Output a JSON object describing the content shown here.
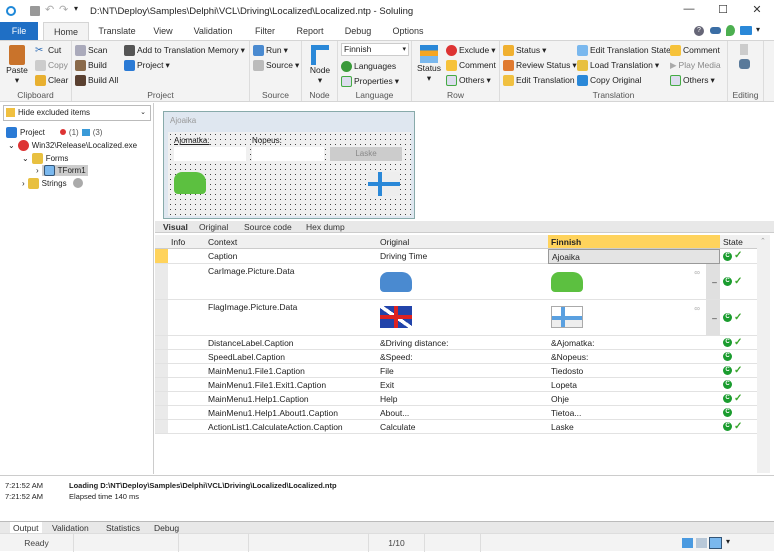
{
  "window": {
    "title": "D:\\NT\\Deploy\\Samples\\Delphi\\VCL\\Driving\\Localized\\Localized.ntp  -  Soluling",
    "minimize": "—",
    "maximize": "☐",
    "close": "✕"
  },
  "menu_tabs": [
    "File",
    "Home",
    "Translate",
    "View",
    "Validation",
    "Filter",
    "Report",
    "Debug",
    "Options"
  ],
  "ribbon": {
    "clipboard": {
      "label": "Clipboard",
      "paste": "Paste",
      "cut": "Cut",
      "copy": "Copy",
      "clear": "Clear"
    },
    "project": {
      "label": "Project",
      "scan": "Scan",
      "build": "Build",
      "build_all": "Build All",
      "add_tm": "Add to Translation Memory",
      "project": "Project"
    },
    "source": {
      "label": "Source",
      "run": "Run",
      "source": "Source"
    },
    "node": {
      "label": "Node",
      "node": "Node"
    },
    "language": {
      "label": "Language",
      "selected": "Finnish",
      "languages": "Languages",
      "properties": "Properties"
    },
    "row": {
      "label": "Row",
      "status": "Status",
      "exclude": "Exclude",
      "comment": "Comment",
      "others": "Others"
    },
    "translation": {
      "label": "Translation",
      "status": "Status",
      "review_status": "Review Status",
      "edit_translation": "Edit Translation",
      "edit_state": "Edit Translation State",
      "load_translation": "Load Translation",
      "copy_original": "Copy Original",
      "comment": "Comment",
      "play_media": "Play Media",
      "others": "Others"
    },
    "editing": {
      "label": "Editing"
    }
  },
  "left": {
    "filter": "Hide excluded items",
    "tree": {
      "project": "Project",
      "project_badges": [
        "(1)",
        "(3)"
      ],
      "exe": "Win32\\Release\\Localized.exe",
      "forms": "Forms",
      "tform": "TForm1",
      "strings": "Strings"
    }
  },
  "preview": {
    "form_title": "Ajoaika",
    "distance_label": "Ajomatka:",
    "speed_label": "Nopeus:",
    "button": "Laske"
  },
  "view_tabs": [
    "Visual",
    "Original",
    "Source code",
    "Hex dump"
  ],
  "grid": {
    "columns": [
      "Info",
      "Context",
      "Original",
      "Finnish",
      "State"
    ],
    "rows": [
      {
        "context": "Caption",
        "original": "Driving Time",
        "translation": "Ajoaika",
        "state": "c-check"
      },
      {
        "context": "CarImage.Picture.Data",
        "original": "[car image]",
        "translation": "[green car image]",
        "state": "c-check"
      },
      {
        "context": "FlagImage.Picture.Data",
        "original": "[UK flag]",
        "translation": "[Finnish flag]",
        "state": "c-check"
      },
      {
        "context": "DistanceLabel.Caption",
        "original": "&Driving distance:",
        "translation": "&Ajomatka:",
        "state": "c-check"
      },
      {
        "context": "SpeedLabel.Caption",
        "original": "&Speed:",
        "translation": "&Nopeus:",
        "state": "c"
      },
      {
        "context": "MainMenu1.File1.Caption",
        "original": "File",
        "translation": "Tiedosto",
        "state": "c-check"
      },
      {
        "context": "MainMenu1.File1.Exit1.Caption",
        "original": "Exit",
        "translation": "Lopeta",
        "state": "c"
      },
      {
        "context": "MainMenu1.Help1.Caption",
        "original": "Help",
        "translation": "Ohje",
        "state": "c-check"
      },
      {
        "context": "MainMenu1.Help1.About1.Caption",
        "original": "About...",
        "translation": "Tietoa...",
        "state": "c"
      },
      {
        "context": "ActionList1.CalculateAction.Caption",
        "original": "Calculate",
        "translation": "Laske",
        "state": "c-check"
      }
    ]
  },
  "output": {
    "lines": [
      {
        "time": "7:21:52 AM",
        "text": "Loading D:\\NT\\Deploy\\Samples\\Delphi\\VCL\\Driving\\Localized\\Localized.ntp",
        "bold": true
      },
      {
        "time": "7:21:52 AM",
        "text": "Elapsed time 140 ms",
        "bold": false
      }
    ]
  },
  "output_tabs": [
    "Output",
    "Validation",
    "Statistics",
    "Debug"
  ],
  "status": {
    "text": "Ready",
    "position": "1/10"
  },
  "colors": {
    "file_tab": "#1f6fc5",
    "finnish_header": "#ffd35c",
    "state_green": "#1a9c2e"
  }
}
